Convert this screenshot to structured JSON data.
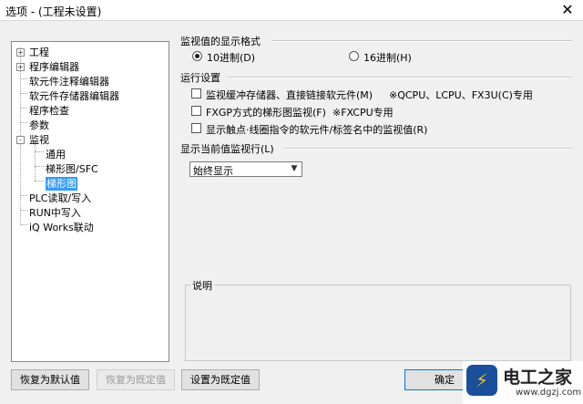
{
  "window": {
    "title": "选项 - (工程未设置)"
  },
  "tree": {
    "items": [
      {
        "label": "工程",
        "expander": "+"
      },
      {
        "label": "程序编辑器",
        "expander": "+"
      },
      {
        "label": "软元件注释编辑器"
      },
      {
        "label": "软元件存储器编辑器"
      },
      {
        "label": "程序检查"
      },
      {
        "label": "参数"
      },
      {
        "label": "监视",
        "expander": "-"
      },
      {
        "label": "通用"
      },
      {
        "label": "梯形图/SFC"
      },
      {
        "label": "梯形图",
        "selected": true
      },
      {
        "label": "PLC读取/写入"
      },
      {
        "label": "RUN中写入"
      },
      {
        "label": "iQ Works联动"
      }
    ]
  },
  "display_format": {
    "title": "监视值的显示格式",
    "option_decimal": "10进制(D)",
    "option_hex": "16进制(H)",
    "selected": "10进制(D)"
  },
  "run_settings": {
    "title": "运行设置",
    "options": [
      {
        "label": "监视缓冲存储器、直接链接软元件(M)",
        "note": "※QCPU、LCPU、FX3U(C)专用",
        "checked": false
      },
      {
        "label": "FXGP方式的梯形图监视(F)",
        "note": "※FXCPU专用",
        "checked": false
      },
      {
        "label": "显示触点·线圈指令的软元件/标签名中的监视值(R)",
        "checked": false
      }
    ]
  },
  "current_row": {
    "title": "显示当前值监视行(L)",
    "selected": "始终显示"
  },
  "description": {
    "title": "说明"
  },
  "buttons": {
    "restore_default": "恢复为默认值",
    "restore_preset": "恢复为既定值",
    "set_preset": "设置为既定值",
    "ok": "确定"
  },
  "watermark": {
    "name": "电工之家",
    "url": "www.dgzj.com"
  },
  "icons": {
    "close": "close-icon",
    "dropdown": "chevron-down-icon",
    "logo": "lightning-logo"
  }
}
